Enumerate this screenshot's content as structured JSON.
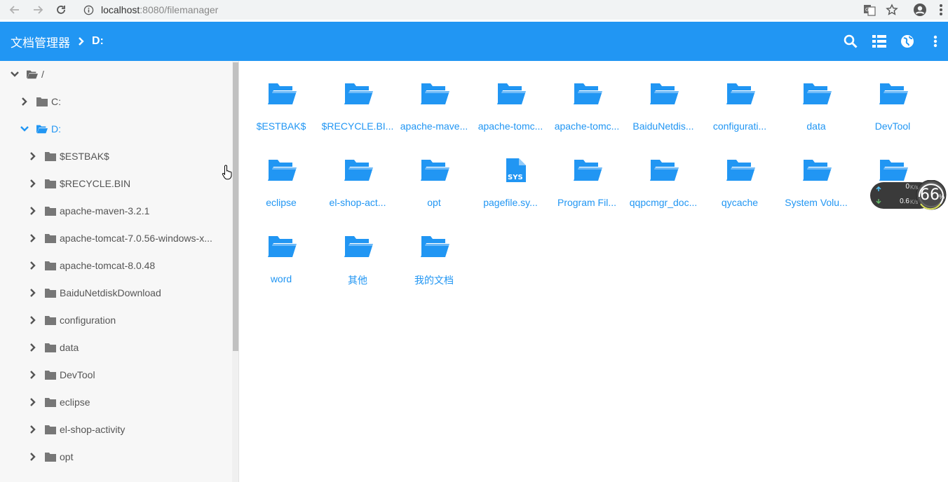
{
  "browser": {
    "url_host": "localhost",
    "url_rest": ":8080/filemanager"
  },
  "header": {
    "app_title": "文档管理器",
    "current_path": "D:"
  },
  "sidebar": {
    "root_label": "/",
    "items": [
      {
        "label": "C:",
        "level": 1,
        "expanded": false,
        "active": false
      },
      {
        "label": "D:",
        "level": 1,
        "expanded": true,
        "active": true
      },
      {
        "label": "$ESTBAK$",
        "level": 2
      },
      {
        "label": "$RECYCLE.BIN",
        "level": 2
      },
      {
        "label": "apache-maven-3.2.1",
        "level": 2
      },
      {
        "label": "apache-tomcat-7.0.56-windows-x...",
        "level": 2
      },
      {
        "label": "apache-tomcat-8.0.48",
        "level": 2
      },
      {
        "label": "BaiduNetdiskDownload",
        "level": 2
      },
      {
        "label": "configuration",
        "level": 2
      },
      {
        "label": "data",
        "level": 2
      },
      {
        "label": "DevTool",
        "level": 2
      },
      {
        "label": "eclipse",
        "level": 2
      },
      {
        "label": "el-shop-activity",
        "level": 2
      },
      {
        "label": "opt",
        "level": 2
      }
    ]
  },
  "files": [
    {
      "label": "$ESTBAK$",
      "type": "folder"
    },
    {
      "label": "$RECYCLE.BI...",
      "type": "folder"
    },
    {
      "label": "apache-mave...",
      "type": "folder"
    },
    {
      "label": "apache-tomc...",
      "type": "folder"
    },
    {
      "label": "apache-tomc...",
      "type": "folder"
    },
    {
      "label": "BaiduNetdis...",
      "type": "folder"
    },
    {
      "label": "configurati...",
      "type": "folder"
    },
    {
      "label": "data",
      "type": "folder"
    },
    {
      "label": "DevTool",
      "type": "folder"
    },
    {
      "label": "eclipse",
      "type": "folder"
    },
    {
      "label": "el-shop-act...",
      "type": "folder"
    },
    {
      "label": "opt",
      "type": "folder"
    },
    {
      "label": "pagefile.sy...",
      "type": "sys-file",
      "badge": "SYS"
    },
    {
      "label": "Program Fil...",
      "type": "folder"
    },
    {
      "label": "qqpcmgr_doc...",
      "type": "folder"
    },
    {
      "label": "qycache",
      "type": "folder"
    },
    {
      "label": "System Volu...",
      "type": "folder"
    },
    {
      "label": "",
      "type": "folder"
    },
    {
      "label": "word",
      "type": "folder"
    },
    {
      "label": "其他",
      "type": "folder"
    },
    {
      "label": "我的文档",
      "type": "folder"
    }
  ],
  "net_widget": {
    "upload": "0",
    "upload_unit": "K/s",
    "download": "0.6",
    "download_unit": "K/s",
    "percent": "66",
    "percent_unit": "%"
  },
  "colors": {
    "accent": "#2196f3",
    "folder_gray": "#8a8a8a"
  }
}
